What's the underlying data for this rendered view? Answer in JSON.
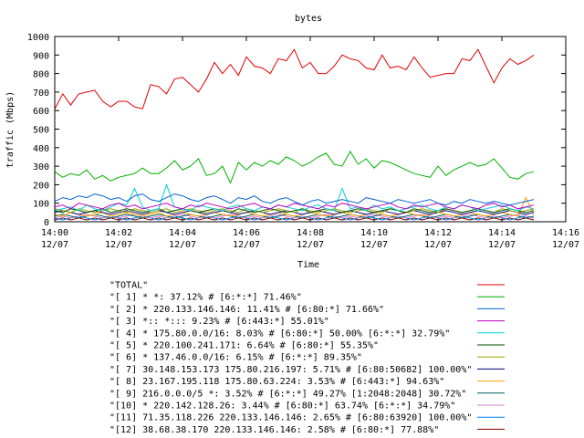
{
  "chart_data": {
    "type": "line",
    "title": "bytes",
    "xlabel": "Time",
    "ylabel": "traffic (Mbps)",
    "ylim": [
      0,
      1000
    ],
    "xlim": [
      "2007-12-07 14:00",
      "2007-12-07 14:16"
    ],
    "grid": false,
    "legend_position": "bottom",
    "y_ticks": [
      "0",
      "100",
      "200",
      "300",
      "400",
      "500",
      "600",
      "700",
      "800",
      "900",
      "1000"
    ],
    "x_ticks": [
      {
        "time": "14:00",
        "date": "12/07"
      },
      {
        "time": "14:02",
        "date": "12/07"
      },
      {
        "time": "14:04",
        "date": "12/07"
      },
      {
        "time": "14:06",
        "date": "12/07"
      },
      {
        "time": "14:08",
        "date": "12/07"
      },
      {
        "time": "14:10",
        "date": "12/07"
      },
      {
        "time": "14:12",
        "date": "12/07"
      },
      {
        "time": "14:14",
        "date": "12/07"
      },
      {
        "time": "14:16",
        "date": "12/07"
      }
    ],
    "x": [
      "14:00:00",
      "14:00:15",
      "14:00:30",
      "14:00:45",
      "14:01:00",
      "14:01:15",
      "14:01:30",
      "14:01:45",
      "14:02:00",
      "14:02:15",
      "14:02:30",
      "14:02:45",
      "14:03:00",
      "14:03:15",
      "14:03:30",
      "14:03:45",
      "14:04:00",
      "14:04:15",
      "14:04:30",
      "14:04:45",
      "14:05:00",
      "14:05:15",
      "14:05:30",
      "14:05:45",
      "14:06:00",
      "14:06:15",
      "14:06:30",
      "14:06:45",
      "14:07:00",
      "14:07:15",
      "14:07:30",
      "14:07:45",
      "14:08:00",
      "14:08:15",
      "14:08:30",
      "14:08:45",
      "14:09:00",
      "14:09:15",
      "14:09:30",
      "14:09:45",
      "14:10:00",
      "14:10:15",
      "14:10:30",
      "14:10:45",
      "14:11:00",
      "14:11:15",
      "14:11:30",
      "14:11:45",
      "14:12:00",
      "14:12:15",
      "14:12:30",
      "14:12:45",
      "14:13:00",
      "14:13:15",
      "14:13:30",
      "14:13:45",
      "14:14:00",
      "14:14:15",
      "14:14:30",
      "14:14:45",
      "14:15:00"
    ],
    "series": [
      {
        "name": "\"TOTAL\"",
        "color": "#e00000",
        "values": [
          610,
          690,
          630,
          690,
          700,
          710,
          650,
          620,
          650,
          650,
          620,
          610,
          740,
          730,
          690,
          770,
          780,
          740,
          700,
          770,
          860,
          800,
          850,
          790,
          890,
          840,
          830,
          800,
          880,
          870,
          930,
          830,
          860,
          800,
          800,
          840,
          900,
          880,
          870,
          830,
          820,
          900,
          830,
          840,
          820,
          890,
          830,
          780,
          790,
          800,
          800,
          880,
          870,
          930,
          840,
          750,
          830,
          880,
          850,
          870,
          900
        ]
      },
      {
        "name": "\"[ 1] * *: 37.12% # [6:*:*] 71.46%\"",
        "color": "#00b000",
        "values": [
          270,
          240,
          260,
          250,
          280,
          230,
          250,
          220,
          240,
          250,
          260,
          290,
          260,
          260,
          290,
          330,
          280,
          300,
          340,
          250,
          260,
          300,
          210,
          320,
          280,
          320,
          300,
          330,
          310,
          350,
          330,
          300,
          320,
          350,
          370,
          310,
          300,
          380,
          310,
          340,
          290,
          330,
          320,
          300,
          280,
          260,
          250,
          240,
          300,
          250,
          280,
          300,
          320,
          300,
          310,
          340,
          290,
          240,
          230,
          260,
          270
        ]
      },
      {
        "name": "\"[ 2] * 220.133.146.146: 11.41% # [6:80:*] 71.66%\"",
        "color": "#0060d0",
        "values": [
          110,
          130,
          120,
          140,
          130,
          150,
          140,
          120,
          130,
          110,
          140,
          150,
          120,
          110,
          130,
          150,
          140,
          120,
          110,
          130,
          140,
          120,
          100,
          130,
          120,
          140,
          110,
          100,
          120,
          130,
          110,
          90,
          110,
          120,
          100,
          110,
          120,
          110,
          100,
          130,
          120,
          110,
          100,
          120,
          110,
          100,
          110,
          120,
          100,
          90,
          110,
          100,
          120,
          110,
          100,
          110,
          100,
          90,
          100,
          110,
          120
        ]
      },
      {
        "name": "\"[ 3] *:: *::: 9.23% # [6:443:*] 55.01%\"",
        "color": "#c000c0",
        "values": [
          80,
          90,
          70,
          100,
          90,
          80,
          70,
          90,
          100,
          80,
          90,
          70,
          80,
          90,
          100,
          80,
          70,
          90,
          80,
          100,
          90,
          80,
          70,
          80,
          90,
          100,
          80,
          70,
          90,
          80,
          100,
          90,
          80,
          70,
          90,
          80,
          100,
          90,
          80,
          70,
          80,
          90,
          100,
          80,
          70,
          90,
          80,
          90,
          100,
          80,
          70,
          90,
          80,
          70,
          90,
          100,
          80,
          90,
          70,
          80,
          90
        ]
      },
      {
        "name": "\"[ 4] * 175.80.0.0/16: 8.03% # [6:80:*] 50.00% [6:*:*] 32.79%\"",
        "color": "#00d0d0",
        "values": [
          60,
          70,
          80,
          60,
          90,
          70,
          60,
          80,
          100,
          90,
          180,
          80,
          60,
          70,
          200,
          80,
          70,
          60,
          90,
          80,
          70,
          60,
          80,
          90,
          70,
          60,
          80,
          70,
          90,
          80,
          70,
          60,
          80,
          90,
          70,
          60,
          180,
          70,
          80,
          60,
          90,
          70,
          80,
          60,
          70,
          80,
          90,
          70,
          60,
          80,
          70,
          90,
          80,
          60,
          70,
          80,
          90,
          70,
          60,
          80,
          70
        ]
      },
      {
        "name": "\"[ 5] * 220.100.241.171: 6.64% # [6:80:*] 55.35%\"",
        "color": "#005000",
        "values": [
          60,
          50,
          70,
          60,
          50,
          60,
          70,
          50,
          60,
          70,
          60,
          50,
          60,
          70,
          50,
          60,
          70,
          60,
          50,
          60,
          70,
          60,
          50,
          70,
          60,
          50,
          60,
          70,
          60,
          50,
          60,
          70,
          50,
          60,
          70,
          60,
          50,
          60,
          70,
          60,
          50,
          60,
          70,
          60,
          50,
          70,
          60,
          50,
          60,
          70,
          60,
          50,
          60,
          70,
          60,
          50,
          60,
          70,
          60,
          50,
          60
        ]
      },
      {
        "name": "\"[ 6] * 137.46.0.0/16: 6.15% # [6:*:*] 89.35%\"",
        "color": "#a0a000",
        "values": [
          70,
          60,
          50,
          70,
          60,
          50,
          60,
          70,
          60,
          50,
          70,
          60,
          50,
          60,
          70,
          50,
          60,
          70,
          60,
          50,
          60,
          70,
          60,
          50,
          70,
          60,
          50,
          60,
          70,
          60,
          50,
          70,
          60,
          50,
          60,
          70,
          60,
          50,
          60,
          70,
          60,
          50,
          70,
          60,
          50,
          60,
          70,
          60,
          50,
          70,
          60,
          50,
          60,
          70,
          60,
          50,
          70,
          60,
          50,
          60,
          70
        ]
      },
      {
        "name": "\"[ 7] 30.148.153.173 175.80.216.197: 5.71% # [6:80:50682] 100.00%\"",
        "color": "#000080",
        "values": [
          50,
          60,
          50,
          40,
          50,
          60,
          50,
          40,
          50,
          60,
          50,
          40,
          50,
          60,
          50,
          40,
          50,
          60,
          50,
          40,
          50,
          60,
          50,
          40,
          50,
          60,
          50,
          40,
          50,
          60,
          50,
          40,
          50,
          60,
          50,
          40,
          50,
          60,
          50,
          40,
          50,
          60,
          50,
          40,
          50,
          60,
          50,
          40,
          50,
          60,
          50,
          40,
          50,
          60,
          50,
          40,
          50,
          60,
          50,
          40,
          50
        ]
      },
      {
        "name": "\"[ 8] 23.167.195.118 175.80.63.224: 3.53% # [6:443:*] 94.63%\"",
        "color": "#ffa000",
        "values": [
          40,
          30,
          50,
          40,
          30,
          40,
          50,
          30,
          40,
          50,
          40,
          30,
          40,
          50,
          30,
          40,
          50,
          40,
          30,
          40,
          50,
          40,
          30,
          40,
          50,
          40,
          30,
          40,
          50,
          40,
          30,
          40,
          50,
          40,
          30,
          40,
          50,
          40,
          30,
          40,
          50,
          40,
          30,
          40,
          50,
          40,
          30,
          40,
          50,
          40,
          30,
          40,
          50,
          40,
          30,
          40,
          50,
          40,
          30,
          130,
          40
        ]
      },
      {
        "name": "\"[ 9] 216.0.0.0/5 *: 3.52% # [6:*:*] 49.27% [1:2048:2048] 30.72%\"",
        "color": "#006060",
        "values": [
          30,
          40,
          30,
          20,
          30,
          40,
          30,
          20,
          30,
          40,
          30,
          20,
          30,
          40,
          30,
          20,
          30,
          40,
          30,
          20,
          30,
          40,
          30,
          20,
          30,
          40,
          30,
          20,
          30,
          40,
          30,
          20,
          30,
          40,
          30,
          20,
          30,
          40,
          30,
          20,
          30,
          40,
          30,
          20,
          30,
          40,
          30,
          20,
          30,
          40,
          30,
          20,
          30,
          40,
          30,
          20,
          30,
          40,
          30,
          20,
          30
        ]
      },
      {
        "name": "\"[10] * 220.142.128.26: 3.44% # [6:80:*] 63.74% [6:*:*] 34.79%\"",
        "color": "#d080d0",
        "values": [
          20,
          30,
          20,
          30,
          40,
          30,
          20,
          30,
          20,
          30,
          40,
          30,
          20,
          30,
          20,
          30,
          40,
          30,
          20,
          30,
          20,
          30,
          40,
          30,
          20,
          30,
          20,
          30,
          40,
          30,
          20,
          30,
          20,
          30,
          40,
          30,
          20,
          30,
          20,
          30,
          40,
          30,
          20,
          30,
          20,
          30,
          40,
          30,
          20,
          30,
          20,
          30,
          40,
          30,
          20,
          30,
          20,
          30,
          40,
          30,
          20
        ]
      },
      {
        "name": "\"[11] 71.35.118.226 220.133.146.146: 2.65% # [6:80:63920] 100.00%\"",
        "color": "#0080ff",
        "values": [
          20,
          10,
          20,
          30,
          20,
          10,
          20,
          30,
          20,
          10,
          20,
          30,
          20,
          10,
          20,
          30,
          20,
          10,
          20,
          30,
          20,
          10,
          20,
          30,
          20,
          10,
          20,
          30,
          20,
          10,
          20,
          30,
          20,
          10,
          20,
          30,
          20,
          10,
          20,
          30,
          20,
          10,
          20,
          30,
          20,
          10,
          20,
          30,
          20,
          10,
          20,
          30,
          20,
          10,
          20,
          30,
          20,
          10,
          20,
          30,
          20
        ]
      },
      {
        "name": "\"[12] 38.68.38.170 220.133.146.146: 2.58% # [6:80:*] 77.88%\"",
        "color": "#800000",
        "values": [
          10,
          20,
          10,
          20,
          10,
          20,
          10,
          20,
          10,
          20,
          10,
          20,
          10,
          20,
          10,
          20,
          10,
          20,
          10,
          20,
          10,
          20,
          10,
          20,
          10,
          20,
          10,
          20,
          10,
          20,
          10,
          20,
          10,
          20,
          10,
          20,
          10,
          20,
          10,
          20,
          10,
          20,
          10,
          20,
          10,
          20,
          10,
          20,
          10,
          20,
          10,
          20,
          10,
          20,
          10,
          20,
          10,
          20,
          10,
          20,
          10
        ]
      }
    ]
  }
}
